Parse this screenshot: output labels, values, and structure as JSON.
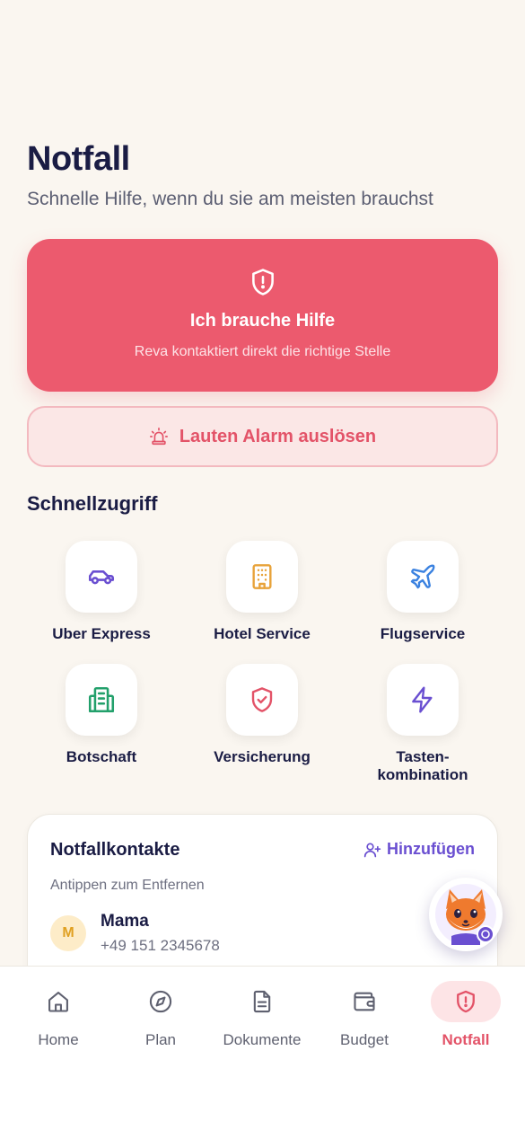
{
  "header": {
    "title": "Notfall",
    "subtitle": "Schnelle Hilfe, wenn du sie am meisten brauchst"
  },
  "help_card": {
    "title": "Ich brauche Hilfe",
    "subtitle": "Reva kontaktiert direkt die richtige Stelle",
    "icon": "shield-alert-icon"
  },
  "alarm": {
    "label": "Lauten Alarm auslösen",
    "icon": "siren-icon"
  },
  "quick_access": {
    "title": "Schnellzugriff",
    "items": [
      {
        "label": "Uber Express",
        "icon": "car-icon",
        "color": "#6a4fd1"
      },
      {
        "label": "Hotel Service",
        "icon": "hotel-icon",
        "color": "#e8a33a"
      },
      {
        "label": "Flugservice",
        "icon": "plane-icon",
        "color": "#3b82e0"
      },
      {
        "label": "Botschaft",
        "icon": "building-icon",
        "color": "#22a06b"
      },
      {
        "label": "Versicherung",
        "icon": "shield-check-icon",
        "color": "#e35368"
      },
      {
        "label": "Tasten-\nkombination",
        "icon": "zap-icon",
        "color": "#6a4fd1"
      }
    ]
  },
  "contacts": {
    "title": "Notfallkontakte",
    "add_label": "Hinzufügen",
    "hint": "Antippen zum Entfernen",
    "items": [
      {
        "initial": "M",
        "name": "Mama",
        "phone": "+49 151 2345678"
      }
    ]
  },
  "tabs": [
    {
      "label": "Home",
      "icon": "home-icon",
      "active": false
    },
    {
      "label": "Plan",
      "icon": "compass-icon",
      "active": false
    },
    {
      "label": "Dokumente",
      "icon": "document-icon",
      "active": false
    },
    {
      "label": "Budget",
      "icon": "wallet-icon",
      "active": false
    },
    {
      "label": "Notfall",
      "icon": "shield-alert-icon",
      "active": true
    }
  ],
  "colors": {
    "accent": "#ec5a6e",
    "primary_text": "#1a1c44",
    "purple": "#6a4fd1",
    "background": "#faf6f0"
  }
}
